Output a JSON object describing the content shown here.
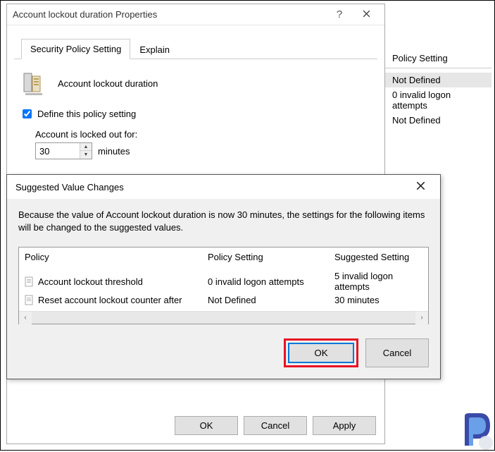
{
  "props": {
    "title": "Account lockout duration Properties",
    "tabs": {
      "security": "Security Policy Setting",
      "explain": "Explain"
    },
    "policy_name": "Account lockout duration",
    "define_label": "Define this policy setting",
    "define_checked": true,
    "locked_for_label": "Account is locked out for:",
    "duration_value": "30",
    "unit": "minutes",
    "buttons": {
      "ok": "OK",
      "cancel": "Cancel",
      "apply": "Apply"
    }
  },
  "right": {
    "header": "Policy Setting",
    "rows": [
      "Not Defined",
      "0 invalid logon attempts",
      "Not Defined"
    ]
  },
  "suggest": {
    "title": "Suggested Value Changes",
    "description": "Because the value of Account lockout duration is now 30 minutes, the settings for the following items will be changed to the suggested values.",
    "cols": {
      "policy": "Policy",
      "setting": "Policy Setting",
      "suggested": "Suggested Setting"
    },
    "rows": [
      {
        "policy": "Account lockout threshold",
        "setting": "0 invalid logon attempts",
        "suggested": "5 invalid logon attempts"
      },
      {
        "policy": "Reset account lockout counter after",
        "setting": "Not Defined",
        "suggested": "30 minutes"
      }
    ],
    "buttons": {
      "ok": "OK",
      "cancel": "Cancel"
    }
  }
}
